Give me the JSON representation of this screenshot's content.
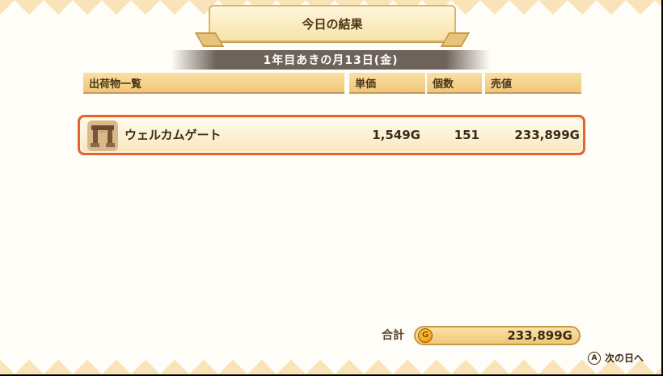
{
  "title": "今日の結果",
  "date": "1年目あきの月13日(金)",
  "columns": {
    "items": "出荷物一覧",
    "unit_price": "単価",
    "count": "個数",
    "sales": "売値"
  },
  "items": [
    {
      "name": "ウェルカムゲート",
      "icon": "welcome-gate-icon",
      "unit_price": "1,549G",
      "count": "151",
      "sales": "233,899G"
    }
  ],
  "total": {
    "label": "合計",
    "coin_glyph": "G",
    "value": "233,899G"
  },
  "next": {
    "button_glyph": "A",
    "label": "次の日へ"
  },
  "colors": {
    "highlight_border": "#e0642c",
    "header_bg": "#efc67a",
    "date_banner_bg": "#6e625a"
  }
}
